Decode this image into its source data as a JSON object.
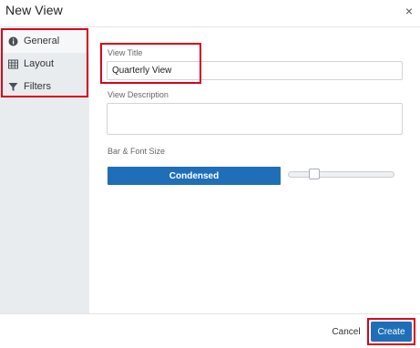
{
  "dialog": {
    "title": "New View",
    "close_glyph": "×"
  },
  "sidebar": {
    "items": [
      {
        "label": "General",
        "icon": "info-circle-icon",
        "active": true
      },
      {
        "label": "Layout",
        "icon": "grid-table-icon",
        "active": false
      },
      {
        "label": "Filters",
        "icon": "filter-funnel-icon",
        "active": false
      }
    ]
  },
  "form": {
    "view_title": {
      "label": "View Title",
      "value": "Quarterly View"
    },
    "view_description": {
      "label": "View Description",
      "value": ""
    },
    "bar_font_size": {
      "label": "Bar & Font Size",
      "option_label": "Condensed",
      "slider_level": 0.25
    }
  },
  "footer": {
    "cancel_label": "Cancel",
    "create_label": "Create"
  },
  "colors": {
    "accent": "#1f6fb8",
    "highlight": "#d9001b",
    "sidebar_bg": "#e9ecef"
  }
}
